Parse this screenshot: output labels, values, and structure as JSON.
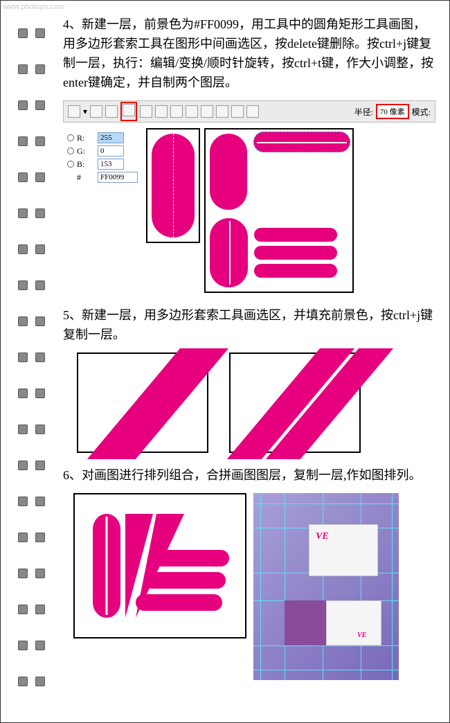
{
  "watermark": "www.photops.com",
  "step4": {
    "text": "4、新建一层，前景色为#FF0099，用工具中的圆角矩形工具画图，用多边形套索工具在图形中间画选区，按delete键删除。按ctrl+j键复制一层，执行：编辑/变换/顺时针旋转，按ctrl+t键，作大小调整，按enter键确定，并自制两个图层。"
  },
  "toolbar": {
    "radius_label": "半径:",
    "radius_value": "70 像素",
    "mode_label": "模式:"
  },
  "color_panel": {
    "r_label": "R:",
    "r_value": "255",
    "g_label": "G:",
    "g_value": "0",
    "b_label": "B:",
    "b_value": "153",
    "hex_label": "#",
    "hex_value": "FF0099"
  },
  "step5": {
    "text": "5、新建一层，用多边形套索工具画选区，并填充前景色，按ctrl+j键复制一层。"
  },
  "step6": {
    "text": "6、对画图进行排列组合，合拼画图图层，复制一层,作如图排列。"
  },
  "chart_data": null
}
